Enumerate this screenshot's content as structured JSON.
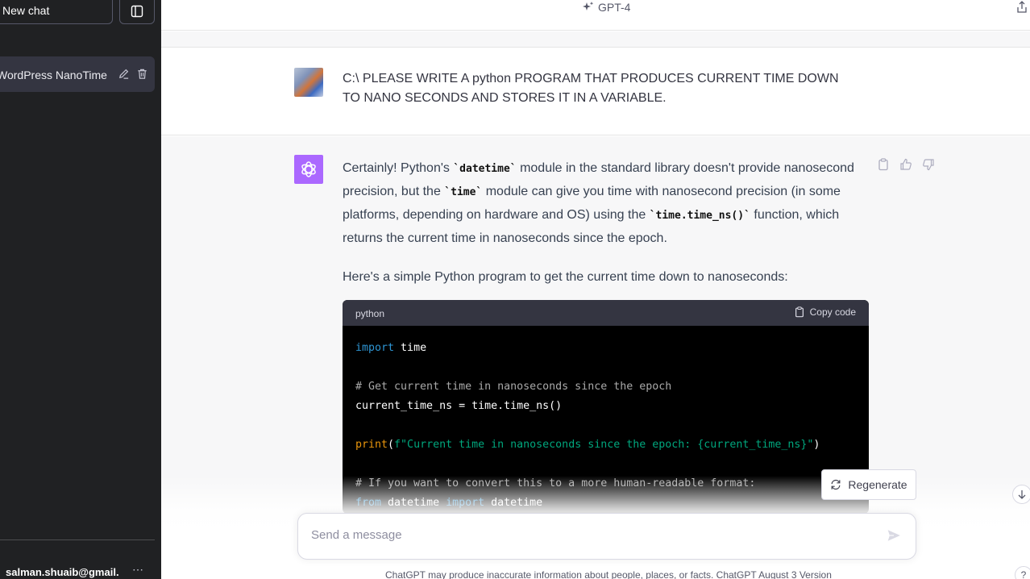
{
  "sidebar": {
    "new_chat_label": "New chat",
    "chat_item_label": "WordPress NanoTime P",
    "user_email": "salman.shuaib@gmail.",
    "user_menu_label": "⋯"
  },
  "header": {
    "model_label": "GPT-4"
  },
  "conversation": {
    "user_message": "C:\\ PLEASE WRITE A python PROGRAM THAT PRODUCES CURRENT TIME DOWN TO NANO SECONDS AND STORES IT IN A VARIABLE.",
    "assistant": {
      "p1_a": "Certainly! Python's ",
      "p1_code1": "`datetime`",
      "p1_b": " module in the standard library doesn't provide nanosecond precision, but the ",
      "p1_code2": "`time`",
      "p1_c": " module can give you time with nanosecond precision (in some platforms, depending on hardware and OS) using the ",
      "p1_code3": "`time.time_ns()`",
      "p1_d": " function, which returns the current time in nanoseconds since the epoch.",
      "p2": "Here's a simple Python program to get the current time down to nanoseconds:"
    },
    "code_block": {
      "language": "python",
      "copy_label": "Copy code",
      "lines": {
        "l1_kw": "import",
        "l1_rest": " time",
        "l3": "# Get current time in nanoseconds since the epoch",
        "l4": "current_time_ns = time.time_ns()",
        "l6_fn": "print",
        "l6_open": "(",
        "l6_str": "f\"Current time in nanoseconds since the epoch: {current_time_ns}\"",
        "l6_close": ")",
        "l8": "# If you want to convert this to a more human-readable format:",
        "l9_kw1": "from",
        "l9_mid": " datetime ",
        "l9_kw2": "import",
        "l9_end": " datetime"
      }
    }
  },
  "composer": {
    "regenerate_label": "Regenerate",
    "placeholder": "Send a message",
    "disclaimer": "ChatGPT may produce inaccurate information about people, places, or facts. ChatGPT August 3 Version",
    "help_label": "?"
  },
  "colors": {
    "sidebar_bg": "#202123",
    "gpt_avatar": "#ab68ff",
    "assistant_bg": "#f7f7f8"
  }
}
